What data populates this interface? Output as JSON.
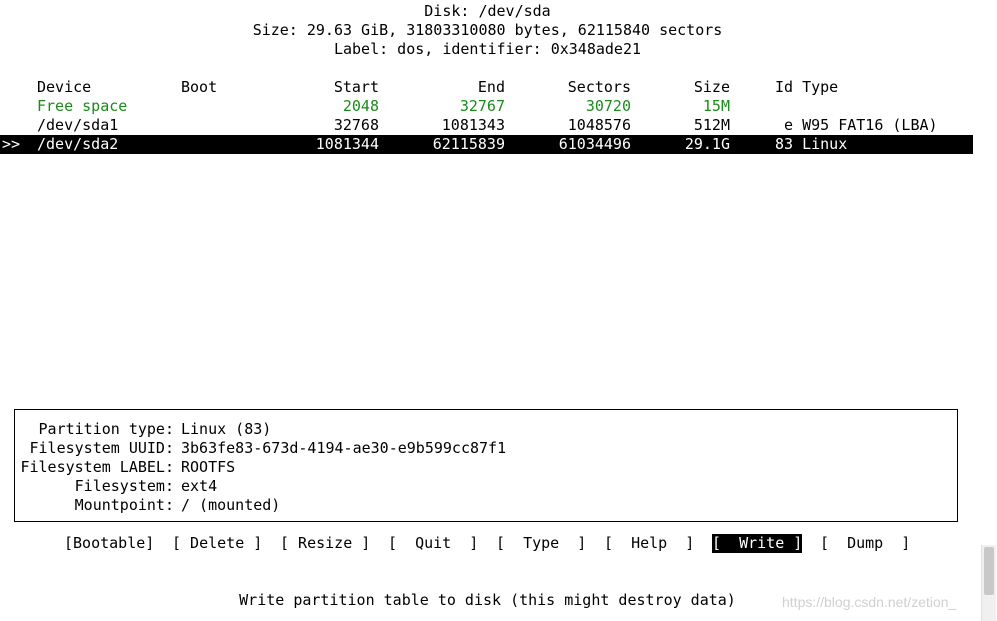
{
  "header": {
    "disk": "Disk: /dev/sda",
    "size": "Size: 29.63 GiB, 31803310080 bytes, 62115840 sectors",
    "label": "Label: dos, identifier: 0x348ade21"
  },
  "table": {
    "columns": {
      "device": "Device",
      "boot": "Boot",
      "start": "Start",
      "end": "End",
      "sectors": "Sectors",
      "size": "Size",
      "idtype": "Id Type"
    },
    "rows": [
      {
        "device": "Free space",
        "boot": "",
        "start": "2048",
        "end": "32767",
        "sectors": "30720",
        "size": "15M",
        "idtype": "",
        "pointer": ""
      },
      {
        "device": "/dev/sda1",
        "boot": "",
        "start": "32768",
        "end": "1081343",
        "sectors": "1048576",
        "size": "512M",
        "idtype": " e W95 FAT16 (LBA)",
        "pointer": ""
      },
      {
        "device": "/dev/sda2",
        "boot": "",
        "start": "1081344",
        "end": "62115839",
        "sectors": "61034496",
        "size": "29.1G",
        "idtype": "83 Linux",
        "pointer": ">>"
      }
    ],
    "selected_index": 2
  },
  "info": {
    "items": [
      {
        "label": "Partition type:",
        "value": "Linux (83)"
      },
      {
        "label": "Filesystem UUID:",
        "value": "3b63fe83-673d-4194-ae30-e9b599cc87f1"
      },
      {
        "label": "Filesystem LABEL:",
        "value": "ROOTFS"
      },
      {
        "label": "Filesystem:",
        "value": "ext4"
      },
      {
        "label": "Mountpoint:",
        "value": "/ (mounted)"
      }
    ]
  },
  "menu": {
    "items": [
      "[Bootable]",
      "[ Delete ]",
      "[ Resize ]",
      "[  Quit  ]",
      "[  Type  ]",
      "[  Help  ]",
      "[  Write ]",
      "[  Dump  ]"
    ],
    "active_index": 6
  },
  "status": {
    "hint": "Write partition table to disk (this might destroy data)"
  },
  "watermark": "https://blog.csdn.net/zetion_"
}
